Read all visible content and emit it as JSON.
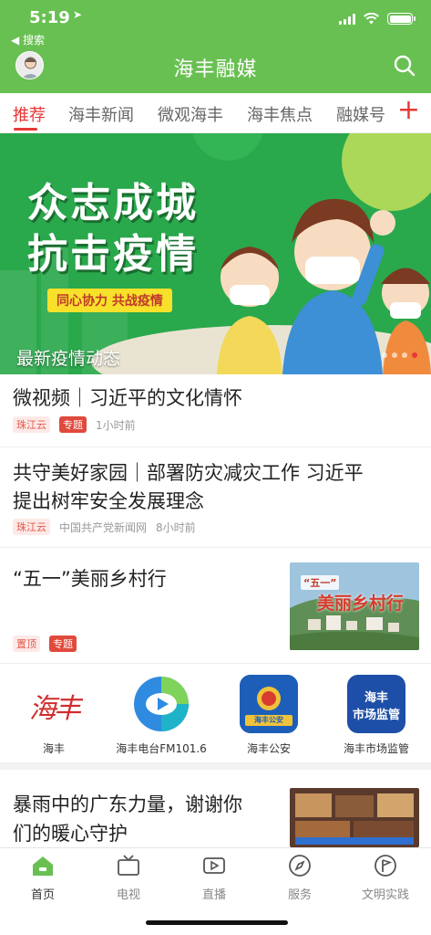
{
  "status_bar": {
    "time": "5:19",
    "back_label": "◀ 搜索"
  },
  "header": {
    "title": "海丰融媒"
  },
  "tabs": [
    {
      "label": "推荐"
    },
    {
      "label": "海丰新闻"
    },
    {
      "label": "微观海丰"
    },
    {
      "label": "海丰焦点"
    },
    {
      "label": "融媒号"
    }
  ],
  "banner": {
    "headline_line1": "众志成城",
    "headline_line2": "抗击疫情",
    "slogan": "同心协力 共战疫情",
    "caption": "最新疫情动态"
  },
  "news": [
    {
      "title": "微视频｜习近平的文化情怀",
      "source": "珠江云",
      "tag": "专题",
      "time": "1小时前"
    },
    {
      "title_line1": "共守美好家园｜部署防灾减灾工作 习近平",
      "title_line2": "提出树牢安全发展理念",
      "source": "珠江云",
      "publisher": "中国共产党新闻网",
      "time": "8小时前"
    },
    {
      "title": "“五一”美丽乡村行",
      "pinned": "置顶",
      "tag": "专题",
      "thumb_text": "美丽乡村行",
      "thumb_badge": "“五一”"
    },
    {
      "title_line1": "暴雨中的广东力量，谢谢你",
      "title_line2": "们的暖心守护"
    }
  ],
  "shortcuts": [
    {
      "label": "海丰",
      "logo_text": "海丰"
    },
    {
      "label": "海丰电台FM101.6"
    },
    {
      "label": "海丰公安",
      "logo_text": "海丰公安"
    },
    {
      "label": "海丰市场监管",
      "logo_line1": "海丰",
      "logo_line2": "市场监管"
    }
  ],
  "bottom_nav": [
    {
      "label": "首页"
    },
    {
      "label": "电视"
    },
    {
      "label": "直播"
    },
    {
      "label": "服务"
    },
    {
      "label": "文明实践"
    }
  ],
  "colors": {
    "brand_green": "#69c052",
    "accent_red": "#e53935"
  }
}
